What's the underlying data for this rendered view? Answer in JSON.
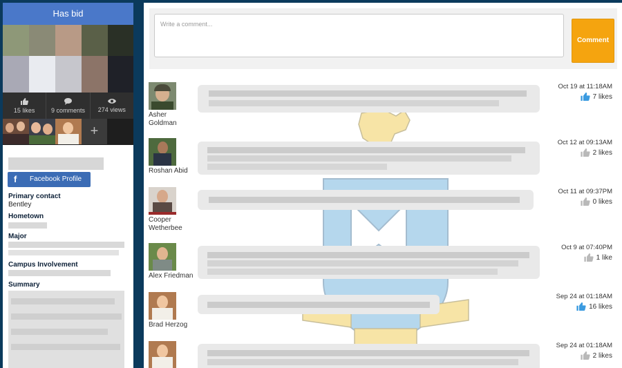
{
  "sidebar": {
    "banner": "Has bid",
    "stats": [
      {
        "icon": "thumbs-up-icon",
        "label": "15 likes"
      },
      {
        "icon": "comment-icon",
        "label": "9 comments"
      },
      {
        "icon": "eye-icon",
        "label": "274 views"
      }
    ],
    "add_friend": "+",
    "facebook_button": "Facebook Profile",
    "facebook_glyph": "f",
    "primary_contact_label": "Primary contact",
    "primary_contact_value": "Bentley",
    "hometown_label": "Hometown",
    "major_label": "Major",
    "campus_label": "Campus Involvement",
    "summary_label": "Summary"
  },
  "composer": {
    "placeholder": "Write a comment...",
    "button": "Comment"
  },
  "comments": [
    {
      "name": "Asher Goldman",
      "time": "Oct 19 at 11:18AM",
      "likes": "7 likes",
      "liked": true
    },
    {
      "name": "Roshan Abid",
      "time": "Oct 12 at 09:13AM",
      "likes": "2 likes",
      "liked": false
    },
    {
      "name": "Cooper Wetherbee",
      "time": "Oct 11 at 09:37PM",
      "likes": "0 likes",
      "liked": false
    },
    {
      "name": "Alex Friedman",
      "time": "Oct 9 at 07:40PM",
      "likes": "1 like",
      "liked": false
    },
    {
      "name": "Brad Herzog",
      "time": "Sep 24 at 01:18AM",
      "likes": "16 likes",
      "liked": true
    },
    {
      "name": "",
      "time": "Sep 24 at 01:18AM",
      "likes": "2 likes",
      "liked": false
    }
  ],
  "colors": {
    "liked": "#3b9be0",
    "unliked": "#b9b9b9",
    "comment_button": "#f5a40f",
    "banner": "#4a78c9",
    "facebook": "#3b6cb5"
  }
}
